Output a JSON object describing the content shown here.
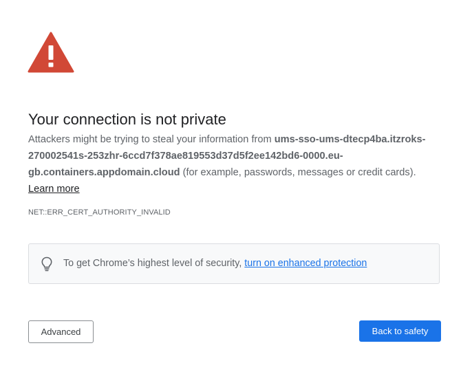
{
  "colors": {
    "warning_red": "#d14836",
    "link_blue": "#1a73e8",
    "primary_button": "#1a73e8",
    "text_dark": "#202124",
    "text_muted": "#5f6368"
  },
  "icons": {
    "warning": "warning-triangle-icon",
    "tip": "lightbulb-icon"
  },
  "title": "Your connection is not private",
  "message": {
    "prefix": "Attackers might be trying to steal your information from ",
    "host": "ums-sso-ums-dtecp4ba.itzroks-270002541s-253zhr-6ccd7f378ae819553d37d5f2ee142bd6-0000.eu-gb.containers.appdomain.cloud",
    "suffix": " (for example, passwords, messages or credit cards). ",
    "learn_more": "Learn more"
  },
  "error_code": "NET::ERR_CERT_AUTHORITY_INVALID",
  "security_tip": {
    "text": "To get Chrome’s highest level of security, ",
    "link": "turn on enhanced protection"
  },
  "buttons": {
    "advanced": "Advanced",
    "back_to_safety": "Back to safety"
  }
}
